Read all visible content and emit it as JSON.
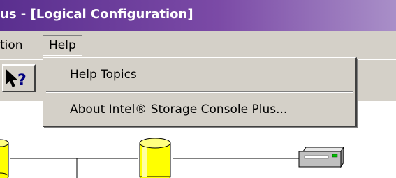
{
  "window": {
    "title": "us - [Logical Configuration]"
  },
  "menubar": {
    "items": [
      {
        "label": "tion"
      },
      {
        "label": "Help"
      }
    ]
  },
  "toolbar": {
    "help_button_icon": "pointer-question-icon",
    "help_button_glyph": "?"
  },
  "help_menu": {
    "items": [
      {
        "label": "Help Topics"
      },
      {
        "label": "About Intel® Storage Console Plus..."
      }
    ]
  },
  "diagram": {
    "nodes": [
      {
        "icon": "cylinder-icon"
      },
      {
        "icon": "cylinder-icon"
      },
      {
        "icon": "disk-drive-icon"
      }
    ]
  },
  "colors": {
    "titlebar_start": "#5a2f8f",
    "titlebar_end": "#a98fc8",
    "face": "#d4d0c8",
    "cylinder_fill": "#ffff00"
  }
}
